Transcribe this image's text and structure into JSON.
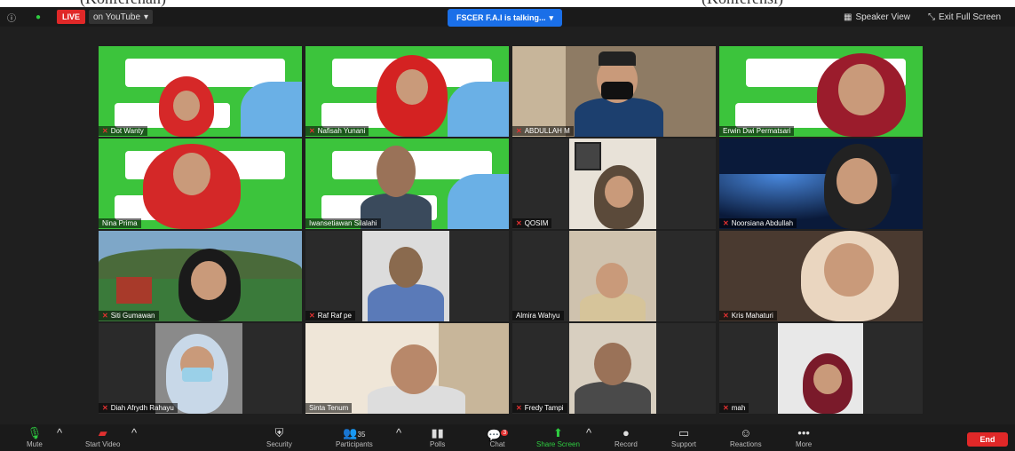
{
  "header_text": {
    "left": "(Konferenan)",
    "right": "(Konferensi)"
  },
  "topbar": {
    "live": "LIVE",
    "stream": "on YouTube",
    "talking": "FSCER F.A.I is talking...",
    "speaker_view": "Speaker View",
    "exit_full": "Exit Full Screen"
  },
  "tiles": [
    {
      "name": "Dot Wanty"
    },
    {
      "name": "Nafisah Yunani"
    },
    {
      "name": "ABDULLAH M"
    },
    {
      "name": "Erwin Dwi Permatsari"
    },
    {
      "name": "Nina Prima"
    },
    {
      "name": "Iwansetiawan Silalahi"
    },
    {
      "name": "QOSIM"
    },
    {
      "name": "Noorsiana Abdullah"
    },
    {
      "name": "Siti Gumawan"
    },
    {
      "name": "Raf Raf pe"
    },
    {
      "name": "Almira Wahyu"
    },
    {
      "name": "Kris Mahaturi"
    },
    {
      "name": "Diah Afrydh Rahayu"
    },
    {
      "name": "Sinta Tenum"
    },
    {
      "name": "Fredy Tampi"
    },
    {
      "name": "mah"
    }
  ],
  "toolbar": {
    "mute": "Mute",
    "start_video": "Start Video",
    "security": "Security",
    "participants": "Participants",
    "participants_count": "35",
    "polls": "Polls",
    "chat": "Chat",
    "chat_badge": "3",
    "share_screen": "Share Screen",
    "record": "Record",
    "support": "Support",
    "reactions": "Reactions",
    "more": "More",
    "end": "End"
  }
}
